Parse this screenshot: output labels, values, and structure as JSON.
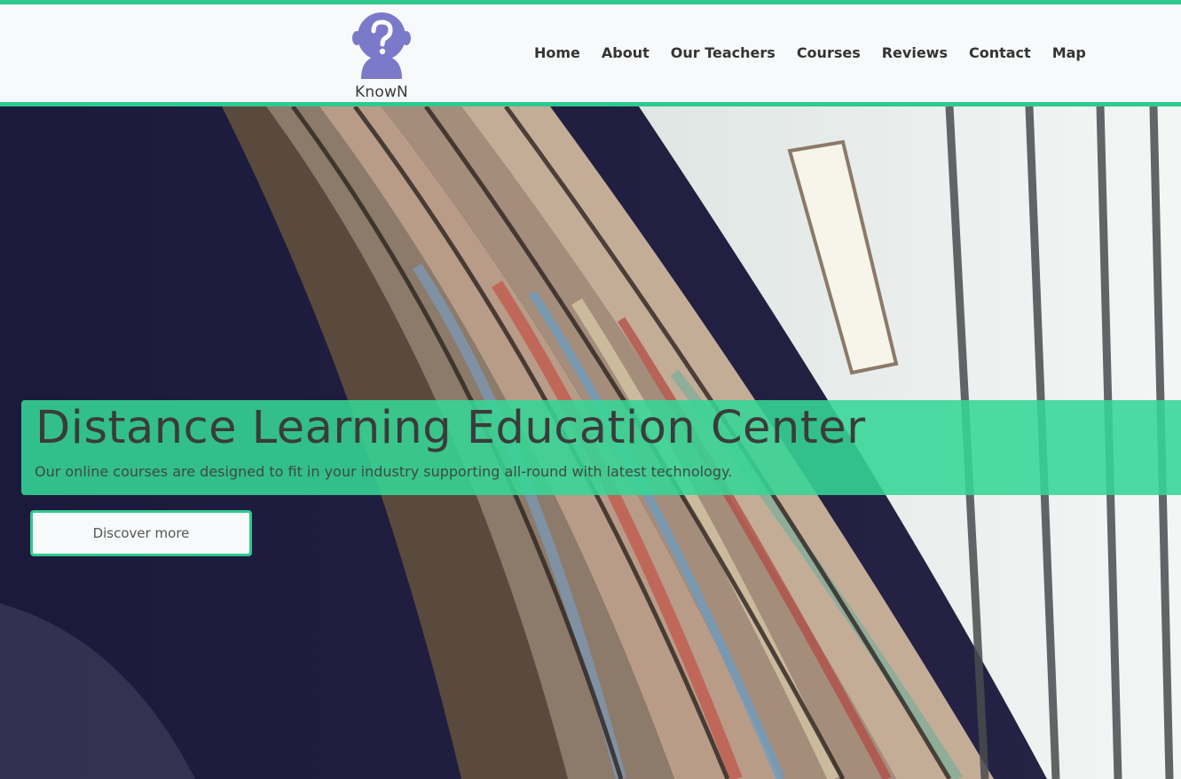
{
  "brand": {
    "name": "KnowN",
    "logo_icon": "question-head-icon",
    "accent": "#2ec98e",
    "logo_color": "#7b79c9"
  },
  "nav": {
    "items": [
      {
        "label": "Home"
      },
      {
        "label": "About"
      },
      {
        "label": "Our Teachers"
      },
      {
        "label": "Courses"
      },
      {
        "label": "Reviews"
      },
      {
        "label": "Contact"
      },
      {
        "label": "Map"
      }
    ]
  },
  "hero": {
    "title": "Distance Learning Education Center",
    "subtitle": "Our online courses are designed to fit in your industry supporting all-round with latest technology.",
    "cta_label": "Discover more",
    "background": "library-bookshelves-image"
  }
}
